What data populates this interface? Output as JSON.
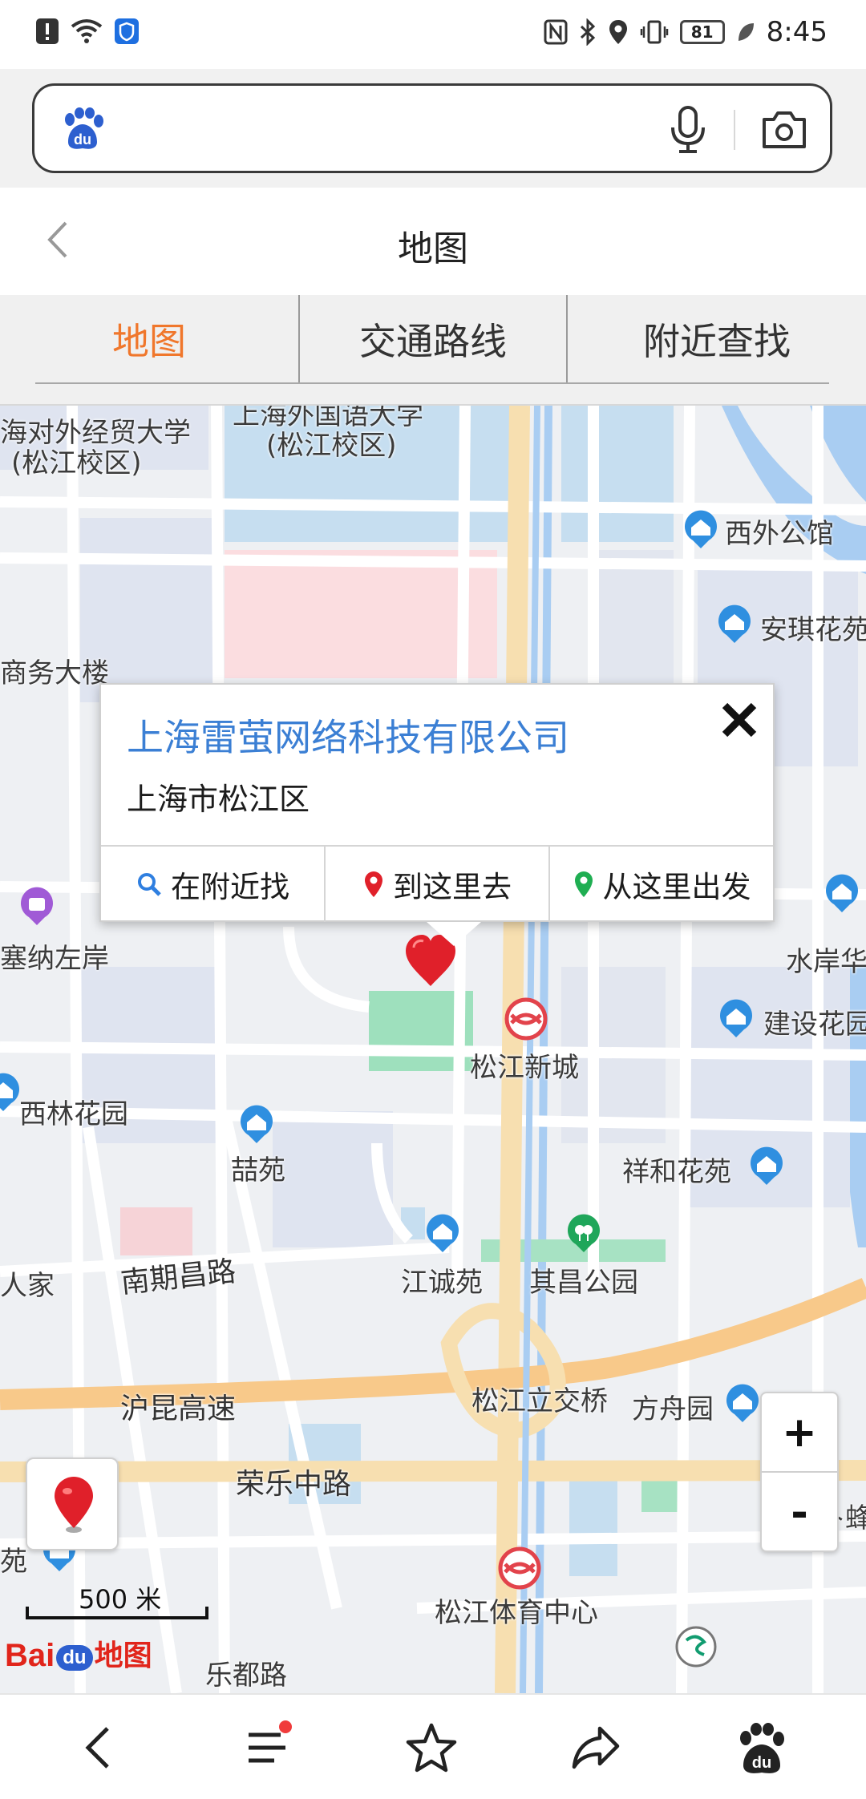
{
  "status_bar": {
    "time": "8:45",
    "battery": "81"
  },
  "search": {
    "placeholder": ""
  },
  "header": {
    "title": "地图"
  },
  "tabs": [
    {
      "label": "地图",
      "active": true
    },
    {
      "label": "交通路线",
      "active": false
    },
    {
      "label": "附近查找",
      "active": false
    }
  ],
  "map": {
    "labels": [
      {
        "text": "海对外经贸大学"
      },
      {
        "text": "(松江校区)"
      },
      {
        "text": "上海外国语大学"
      },
      {
        "text": "(松江校区)"
      },
      {
        "text": "西外公馆"
      },
      {
        "text": "安琪花苑"
      },
      {
        "text": "商务大楼"
      },
      {
        "text": "塞纳左岸"
      },
      {
        "text": "水岸华"
      },
      {
        "text": "建设花园"
      },
      {
        "text": "松江新城"
      },
      {
        "text": "西林花园"
      },
      {
        "text": "喆苑"
      },
      {
        "text": "祥和花苑"
      },
      {
        "text": "南期昌路"
      },
      {
        "text": "江诚苑"
      },
      {
        "text": "其昌公园"
      },
      {
        "text": "人家"
      },
      {
        "text": "沪昆高速"
      },
      {
        "text": "松江立交桥"
      },
      {
        "text": "方舟园"
      },
      {
        "text": "荣乐中路"
      },
      {
        "text": "卜蜂"
      },
      {
        "text": "苑"
      },
      {
        "text": "松江体育中心"
      },
      {
        "text": "乐都路"
      }
    ],
    "popup": {
      "title": "上海雷萤网络科技有限公司",
      "address": "上海市松江区",
      "actions": [
        "在附近找",
        "到这里去",
        "从这里出发"
      ]
    },
    "zoom_in": "+",
    "zoom_out": "-",
    "scale": "500 米",
    "logo": {
      "bai": "Bai",
      "du": "du",
      "map": "地图"
    }
  },
  "colors": {
    "accent_orange": "#f0772c",
    "link_blue": "#3b7fd4",
    "marker_red": "#e0202a",
    "poi_blue": "#2f8fe0"
  }
}
